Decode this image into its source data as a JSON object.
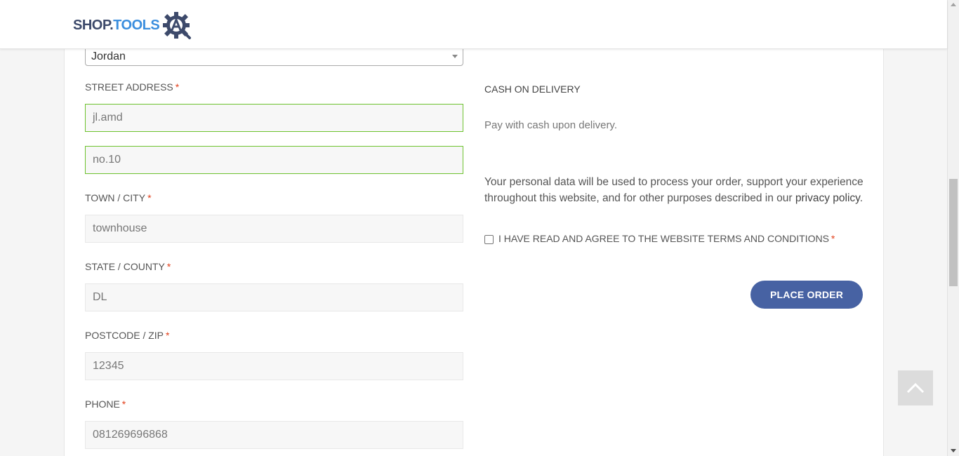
{
  "header": {
    "logo_part1": "SHOP.",
    "logo_part2": "TOOLS",
    "logo_icon": "gear-a-icon"
  },
  "billing": {
    "country_value": "Jordan",
    "street_label": "STREET ADDRESS",
    "street_line1": "jl.amd",
    "street_line2": "no.10",
    "city_label": "TOWN / CITY",
    "city_value": "townhouse",
    "state_label": "STATE / COUNTY",
    "state_value": "DL",
    "postcode_label": "POSTCODE / ZIP",
    "postcode_value": "12345",
    "phone_label": "PHONE",
    "phone_value": "081269696868",
    "required_mark": "*"
  },
  "payment": {
    "method_title": "CASH ON DELIVERY",
    "method_desc": "Pay with cash upon delivery.",
    "privacy_text": "Your personal data will be used to process your order, support your experience throughout this website, and for other purposes described in our",
    "privacy_link": "privacy policy",
    "privacy_end": ".",
    "terms_label": "I HAVE READ AND AGREE TO THE WEBSITE TERMS AND CONDITIONS",
    "place_order_label": "PLACE ORDER"
  },
  "colors": {
    "accent": "#4762a3",
    "valid_border": "#6dc22e",
    "required": "#e2401c"
  }
}
